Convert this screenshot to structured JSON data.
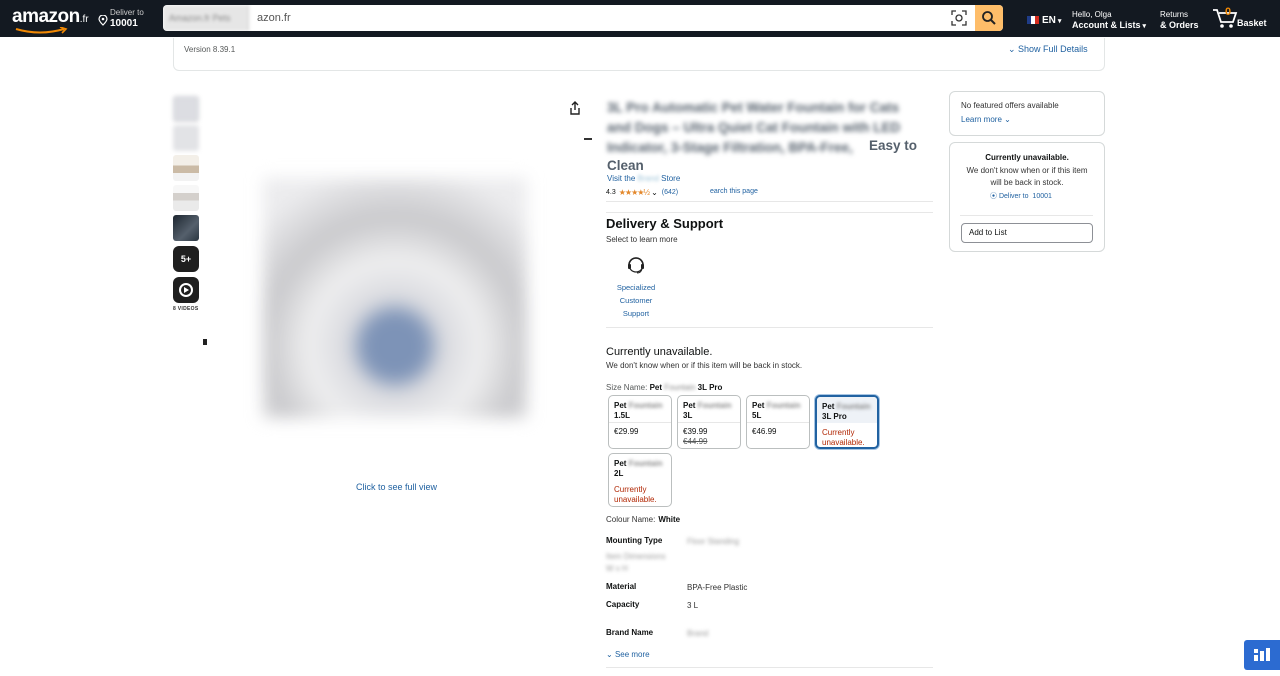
{
  "header": {
    "logo": "amazon",
    "logo_suffix": ".fr",
    "deliver_line1": "Deliver to",
    "deliver_line2": "10001",
    "search_category": "Amazon.fr Pets",
    "search_value": "azon.fr",
    "language": "EN",
    "account_line1": "Hello, Olga",
    "account_line2": "Account & Lists",
    "returns_line1": "Returns",
    "returns_line2": "& Orders",
    "cart_count": "0",
    "cart_label": "Basket"
  },
  "version_bar": {
    "version": "Version 8.39.1",
    "show_full_details": "Show Full Details"
  },
  "gallery": {
    "more_count": "5+",
    "videos_label": "8 VIDEOS",
    "click_full_view": "Click to see full view"
  },
  "product": {
    "title_blurred": "3L Pro Automatic Pet Water Fountain for Cats and Dogs – Ultra Quiet Cat Fountain with LED Indicator, 3-Stage Filtration, BPA-Free,",
    "title_tail": "Easy to",
    "title_last": "Clean",
    "store_prefix": "Visit the",
    "store_name": "Brand",
    "store_suffix": "Store",
    "rating": "4.3",
    "stars": "★★★★½",
    "rating_count": "(642)",
    "search_page": "earch this page"
  },
  "delivery_support": {
    "title": "Delivery & Support",
    "subtitle": "Select to learn more",
    "item_label_1": "Specialized",
    "item_label_2": "Customer",
    "item_label_3": "Support"
  },
  "availability": {
    "title": "Currently unavailable.",
    "subtitle": "We don't know when or if this item will be back in stock."
  },
  "size": {
    "label": "Size Name:",
    "selected_prefix": "Pet",
    "selected_blur": "Fountain",
    "selected_suffix": "3L Pro",
    "options": [
      {
        "name1": "Pet",
        "blur": "Fountain",
        "name2": "1.5L",
        "price": "€29.99",
        "old": ""
      },
      {
        "name1": "Pet",
        "blur": "Fountain",
        "name2": "3L",
        "price": "€39.99",
        "old": "€44.99"
      },
      {
        "name1": "Pet",
        "blur": "Fountain",
        "name2": "5L",
        "price": "€46.99",
        "old": ""
      },
      {
        "name1": "Pet",
        "blur": "Fountain",
        "name2": "3L Pro",
        "unavailable1": "Currently",
        "unavailable2": "unavailable."
      },
      {
        "name1": "Pet",
        "blur": "Fountain",
        "name2": "2L",
        "unavailable1": "Currently",
        "unavailable2": "unavailable."
      }
    ]
  },
  "colour": {
    "label": "Colour Name:",
    "value": "White"
  },
  "specs": {
    "mounting_label": "Mounting Type",
    "mounting_value": "Floor Standing",
    "item_dims_label1": "Item Dimensions",
    "item_dims_label2": "W x H",
    "material_label": "Material",
    "material_value": "BPA-Free Plastic",
    "capacity_label": "Capacity",
    "capacity_value": "3 L",
    "brand_label": "Brand Name",
    "brand_value": "Brand",
    "see_more": "See more"
  },
  "buybox": {
    "no_offers": "No featured offers available",
    "learn_more": "Learn more",
    "unavailable_title": "Currently unavailable.",
    "unavailable_text": "We don't know when or if this item will be back in stock.",
    "deliver_prefix": "Deliver to",
    "deliver_zip": "10001",
    "add_to_list": "Add to List"
  },
  "colors": {
    "header_bg": "#131921",
    "search_button": "#febd69",
    "link": "#2162a1",
    "price_red": "#b12704",
    "star": "#e3872a"
  }
}
